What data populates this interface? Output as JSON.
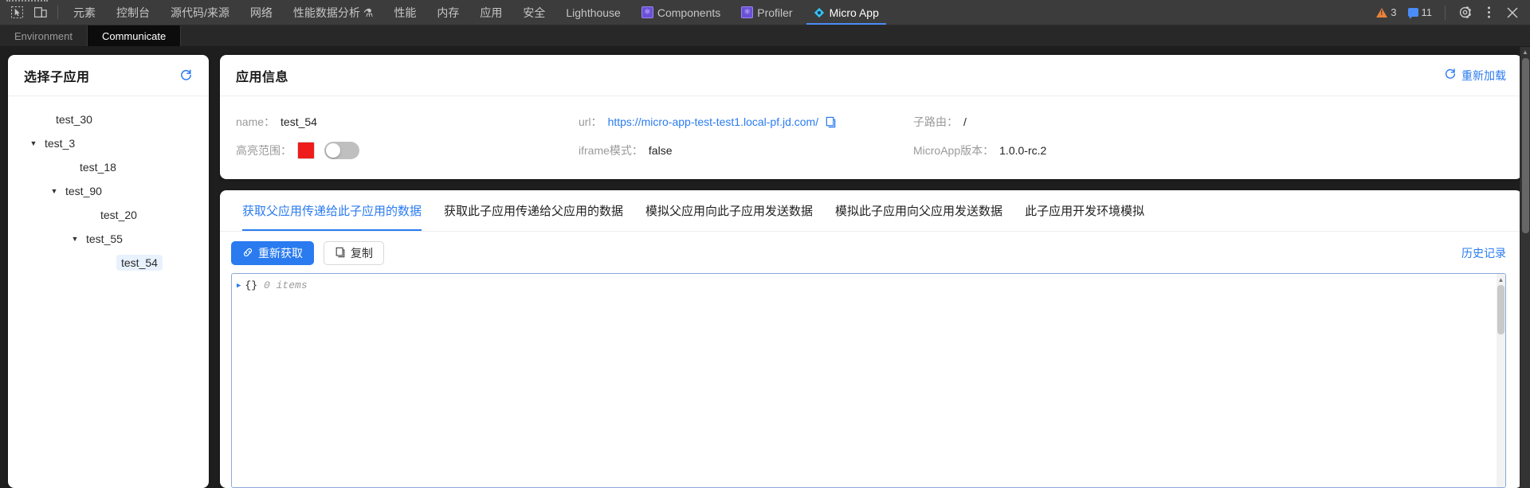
{
  "devtools": {
    "left_icons": [
      "inspect-element-icon",
      "device-toolbar-icon"
    ],
    "tabs": [
      {
        "label": "元素",
        "icon": null,
        "active": false
      },
      {
        "label": "控制台",
        "icon": null,
        "active": false
      },
      {
        "label": "源代码/来源",
        "icon": null,
        "active": false
      },
      {
        "label": "网络",
        "icon": null,
        "active": false
      },
      {
        "label": "性能数据分析 ⚗",
        "icon": null,
        "active": false
      },
      {
        "label": "性能",
        "icon": null,
        "active": false
      },
      {
        "label": "内存",
        "icon": null,
        "active": false
      },
      {
        "label": "应用",
        "icon": null,
        "active": false
      },
      {
        "label": "安全",
        "icon": null,
        "active": false
      },
      {
        "label": "Lighthouse",
        "icon": null,
        "active": false
      },
      {
        "label": "Components",
        "icon": "react-ext-icon",
        "active": false
      },
      {
        "label": "Profiler",
        "icon": "react-ext-icon",
        "active": false
      },
      {
        "label": "Micro App",
        "icon": "micro-app-icon",
        "active": true
      }
    ],
    "warning_count": "3",
    "message_count": "11",
    "settings_icon": "gear-icon",
    "more_icon": "vertical-dots-icon",
    "close_icon": "close-icon"
  },
  "subtabs": [
    {
      "label": "Environment",
      "active": false
    },
    {
      "label": "Communicate",
      "active": true
    }
  ],
  "sidebar": {
    "title": "选择子应用",
    "refresh_icon": "refresh-icon",
    "tree": [
      {
        "label": "test_30",
        "depth": 1,
        "expandable": false,
        "selected": false
      },
      {
        "label": "test_3",
        "depth": 0,
        "expandable": true,
        "selected": false
      },
      {
        "label": "test_18",
        "depth": 2,
        "expandable": false,
        "selected": false
      },
      {
        "label": "test_90",
        "depth": 1,
        "expandable": true,
        "selected": false
      },
      {
        "label": "test_20",
        "depth": 3,
        "expandable": false,
        "selected": false
      },
      {
        "label": "test_55",
        "depth": 2,
        "expandable": true,
        "selected": false
      },
      {
        "label": "test_54",
        "depth": 4,
        "expandable": false,
        "selected": true
      }
    ]
  },
  "app_info": {
    "title": "应用信息",
    "reload_label": "重新加载",
    "reload_icon": "refresh-icon",
    "name_label": "name：",
    "name_value": "test_54",
    "url_label": "url：",
    "url_value": "https://micro-app-test-test1.local-pf.jd.com/",
    "url_copy_icon": "copy-icon",
    "subroute_label": "子路由：",
    "subroute_value": "/",
    "highlight_label": "高亮范围：",
    "highlight_color": "#ee1c1c",
    "highlight_enabled": false,
    "iframe_label": "iframe模式：",
    "iframe_value": "false",
    "version_label": "MicroApp版本：",
    "version_value": "1.0.0-rc.2"
  },
  "communicate": {
    "tabs": [
      {
        "label": "获取父应用传递给此子应用的数据",
        "active": true
      },
      {
        "label": "获取此子应用传递给父应用的数据",
        "active": false
      },
      {
        "label": "模拟父应用向此子应用发送数据",
        "active": false
      },
      {
        "label": "模拟此子应用向父应用发送数据",
        "active": false
      },
      {
        "label": "此子应用开发环境模拟",
        "active": false
      }
    ],
    "refetch_label": "重新获取",
    "refetch_icon": "link-icon",
    "copy_label": "复制",
    "copy_icon": "copy-icon",
    "history_label": "历史记录",
    "json_caret": "▶",
    "json_value": "{}",
    "json_items": "0 items"
  }
}
